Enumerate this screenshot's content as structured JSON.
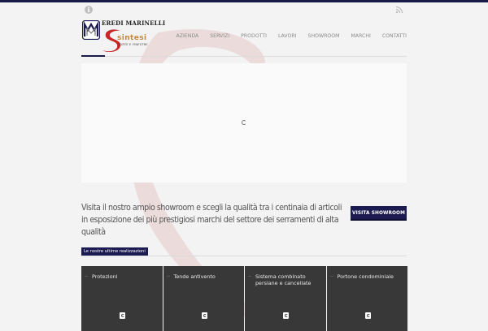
{
  "brand": {
    "company_name": "EREDI MARINELLI",
    "sub_brand": "sintesi",
    "tagline": "PORTE E FINESTRE",
    "accent_color": "#1b1b52",
    "swoosh_color": "#e9d0d0",
    "logo_gold": "#c7873e"
  },
  "topbar": {
    "left_icon": "info-icon",
    "right_icon": "rss-icon"
  },
  "nav": {
    "items": [
      {
        "label": "AZIENDA"
      },
      {
        "label": "SERVIZI"
      },
      {
        "label": "PRODOTTI"
      },
      {
        "label": "LAVORI"
      },
      {
        "label": "SHOWROOM"
      },
      {
        "label": "MARCHI"
      },
      {
        "label": "CONTATTI"
      }
    ]
  },
  "slider": {
    "loader_icon": "spinner-icon"
  },
  "promo": {
    "text": "Visita il nostro ampio showroom e scegli la qualità tra i centinaia di articoli in esposizione dei più prestigiosi marchi del settore dei serramenti di alta qualità",
    "button_label": "VISITA SHOWROOM"
  },
  "works": {
    "section_label": "Le nostre ultime realizzazioni",
    "tiles": [
      {
        "title": "Protezioni"
      },
      {
        "title": "Tende antivento"
      },
      {
        "title": "Sistema combinato persiane e cancellate"
      },
      {
        "title": "Portone condominiale"
      }
    ]
  }
}
